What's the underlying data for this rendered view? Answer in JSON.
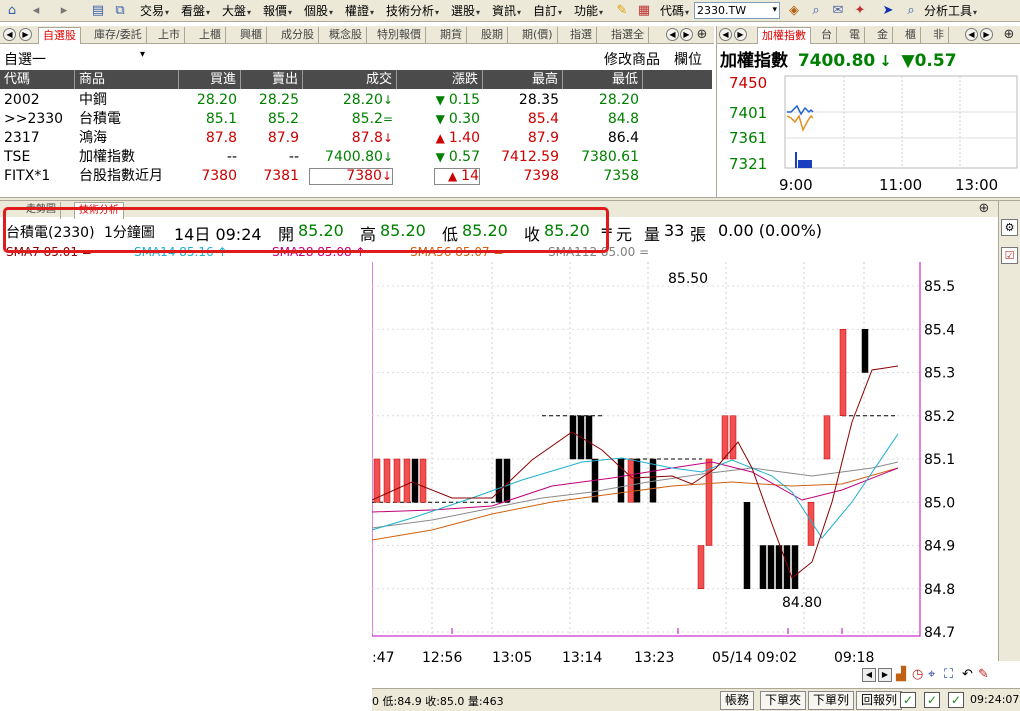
{
  "menubar": {
    "items": [
      "交易",
      "看盤",
      "大盤",
      "報價",
      "個股",
      "權證",
      "技術分析",
      "選股",
      "資訊",
      "自訂",
      "功能"
    ],
    "code_label": "代碼",
    "code_value": "2330.TW",
    "analysis_tools": "分析工具"
  },
  "watch_tabs": [
    "自選股",
    "庫存/委託",
    "上市",
    "上櫃",
    "興櫃",
    "成分股",
    "概念股",
    "特別報價",
    "期貨",
    "股期",
    "期(價)",
    "指選",
    "指選全"
  ],
  "watchlist": {
    "group_name": "自選一",
    "modify_label": "修改商品",
    "columns_label": "欄位",
    "headers": [
      "代碼",
      "商品",
      "買進",
      "賣出",
      "成交",
      "漲跌",
      "最高",
      "最低"
    ],
    "rows": [
      {
        "code": "2002",
        "name": "中鋼",
        "bid": "28.20",
        "ask": "28.25",
        "last": "28.20",
        "last_arrow": "↓",
        "chg_arrow": "▼",
        "chg": "0.15",
        "high": "28.35",
        "low": "28.20",
        "bid_c": "green",
        "ask_c": "green",
        "last_c": "green",
        "chg_c": "green",
        "high_c": "black",
        "low_c": "green"
      },
      {
        "code": ">>2330",
        "name": "台積電",
        "bid": "85.1",
        "ask": "85.2",
        "last": "85.2",
        "last_arrow": "=",
        "chg_arrow": "▼",
        "chg": "0.30",
        "high": "85.4",
        "low": "84.8",
        "bid_c": "green",
        "ask_c": "green",
        "last_c": "green",
        "chg_c": "green",
        "high_c": "red",
        "low_c": "green"
      },
      {
        "code": "2317",
        "name": "鴻海",
        "bid": "87.8",
        "ask": "87.9",
        "last": "87.8",
        "last_arrow": "↓",
        "chg_arrow": "▲",
        "chg": "1.40",
        "high": "87.9",
        "low": "86.4",
        "bid_c": "red",
        "ask_c": "red",
        "last_c": "red",
        "chg_c": "red",
        "high_c": "red",
        "low_c": "black"
      },
      {
        "code": "TSE",
        "name": "加權指數",
        "bid": "--",
        "ask": "--",
        "last": "7400.80",
        "last_arrow": "↓",
        "chg_arrow": "▼",
        "chg": "0.57",
        "high": "7412.59",
        "low": "7380.61",
        "bid_c": "black",
        "ask_c": "black",
        "last_c": "green",
        "chg_c": "green",
        "high_c": "red",
        "low_c": "green"
      },
      {
        "code": "FITX*1",
        "name": "台股指數近月",
        "bid": "7380",
        "ask": "7381",
        "last": "7380",
        "last_arrow": "↓",
        "chg_arrow": "▲",
        "chg": "14",
        "high": "7398",
        "low": "7358",
        "bid_c": "red",
        "ask_c": "red",
        "last_c": "red",
        "chg_c": "red",
        "high_c": "red",
        "low_c": "green"
      }
    ]
  },
  "index_panel": {
    "tabs": [
      "加權指數",
      "台",
      "電",
      "金",
      "櫃",
      "非"
    ],
    "title": "加權指數",
    "value": "7400.80",
    "value_arrow": "↓",
    "change": "▼0.57",
    "y_ticks": [
      "7450",
      "7401",
      "7361",
      "7321"
    ],
    "x_ticks": [
      "9:00",
      "11:00",
      "13:00"
    ]
  },
  "chart_tabs": [
    "走勢圖",
    "技術分析"
  ],
  "quote_bar": {
    "name": "台積電(2330)",
    "period": "1分鐘圖",
    "datetime": "14日 09:24",
    "open_label": "開",
    "open": "85.20",
    "high_label": "高",
    "high": "85.20",
    "low_label": "低",
    "low": "85.20",
    "close_label": "收",
    "close": "85.20",
    "unit_sign": "=",
    "unit": "元",
    "volume_label": "量",
    "volume": "33",
    "volume_unit": "張",
    "change": "0.00 (0.00%)"
  },
  "ma_bar": [
    {
      "label": "SMA7 85.01 =",
      "color": "#8b0000"
    },
    {
      "label": "SMA14 85.16 ↑",
      "color": "#20b0d0"
    },
    {
      "label": "SMA28 85.08 ↑",
      "color": "#c0007a"
    },
    {
      "label": "SMA56 85.07 =",
      "color": "#d06010"
    },
    {
      "label": "SMA112 85.00 =",
      "color": "#808080"
    }
  ],
  "chart_data": {
    "type": "bar",
    "y_ticks": [
      "85.5",
      "85.4",
      "85.3",
      "85.2",
      "85.1",
      "85.0",
      "84.9",
      "84.8",
      "84.7"
    ],
    "ylim": [
      84.7,
      85.5
    ],
    "x_ticks": [
      ":47",
      "12:56",
      "13:05",
      "13:14",
      "13:23",
      "05/14 09:02",
      "09:18"
    ],
    "max_label": "85.50",
    "min_label": "84.80"
  },
  "status_bar": {
    "left_text": "0 低:84.9 收:85.0 量:463",
    "buttons": [
      "帳務",
      "下單夾",
      "下單列",
      "回報列"
    ],
    "time": "09:24:07"
  }
}
